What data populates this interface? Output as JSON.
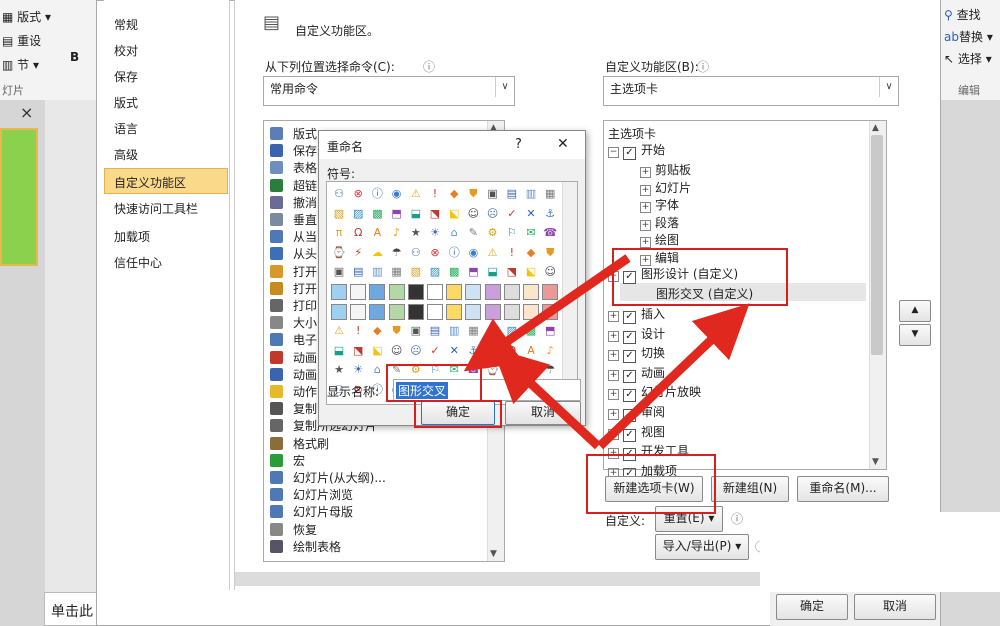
{
  "ribbon": {
    "layout": "版式",
    "reset": "重设",
    "section": "节",
    "slides_group": "灯片",
    "find": "查找",
    "replace": "替换",
    "select": "选择",
    "edit_group": "编辑",
    "bold": "B"
  },
  "slide_pane": {
    "close": "×",
    "click_tip": "单击此"
  },
  "categories": [
    "常规",
    "校对",
    "保存",
    "版式",
    "语言",
    "高级",
    "自定义功能区",
    "快速访问工具栏",
    "加载项",
    "信任中心"
  ],
  "main": {
    "heading": "自定义功能区。",
    "from_label": "从下列位置选择命令(C):",
    "from_value": "常用命令",
    "right_label": "自定义功能区(B):",
    "right_value": "主选项卡",
    "info": "ⓘ"
  },
  "commands": [
    "版式",
    "保存",
    "表格",
    "超链",
    "撤消",
    "垂直",
    "从当",
    "从头",
    "打开",
    "打开",
    "打印",
    "大小",
    "电子",
    "动画",
    "动画",
    "动作",
    "复制",
    "复制所选幻灯片",
    "格式刷",
    "宏",
    "幻灯片(从大纲)...",
    "幻灯片浏览",
    "幻灯片母版",
    "恢复",
    "绘制表格"
  ],
  "tree": {
    "header": "主选项卡",
    "start": "开始",
    "start_children": [
      "剪贴板",
      "幻灯片",
      "字体",
      "段落",
      "绘图",
      "编辑"
    ],
    "custom_tab": "图形设计 (自定义)",
    "custom_group": "图形交叉 (自定义)",
    "rest": [
      "插入",
      "设计",
      "切换",
      "动画",
      "幻灯片放映",
      "审阅",
      "视图",
      "开发工具",
      "加载项"
    ]
  },
  "buttons": {
    "new_tab": "新建选项卡(W)",
    "new_group": "新建组(N)",
    "rename": "重命名(M)...",
    "custom_label": "自定义:",
    "reset": "重置(E)",
    "import_export": "导入/导出(P)",
    "ok": "确定",
    "cancel": "取消",
    "up": "▲",
    "down": "▼"
  },
  "rename_dialog": {
    "title": "重命名",
    "help": "?",
    "close": "✕",
    "symbol_label": "符号:",
    "display_label": "显示名称:",
    "display_value": "图形交叉",
    "ok": "确定",
    "cancel": "取消"
  },
  "colors": {
    "accent_red": "#d62020",
    "selected_cat": "#fbd98a",
    "slide_green": "#8cd14d"
  }
}
